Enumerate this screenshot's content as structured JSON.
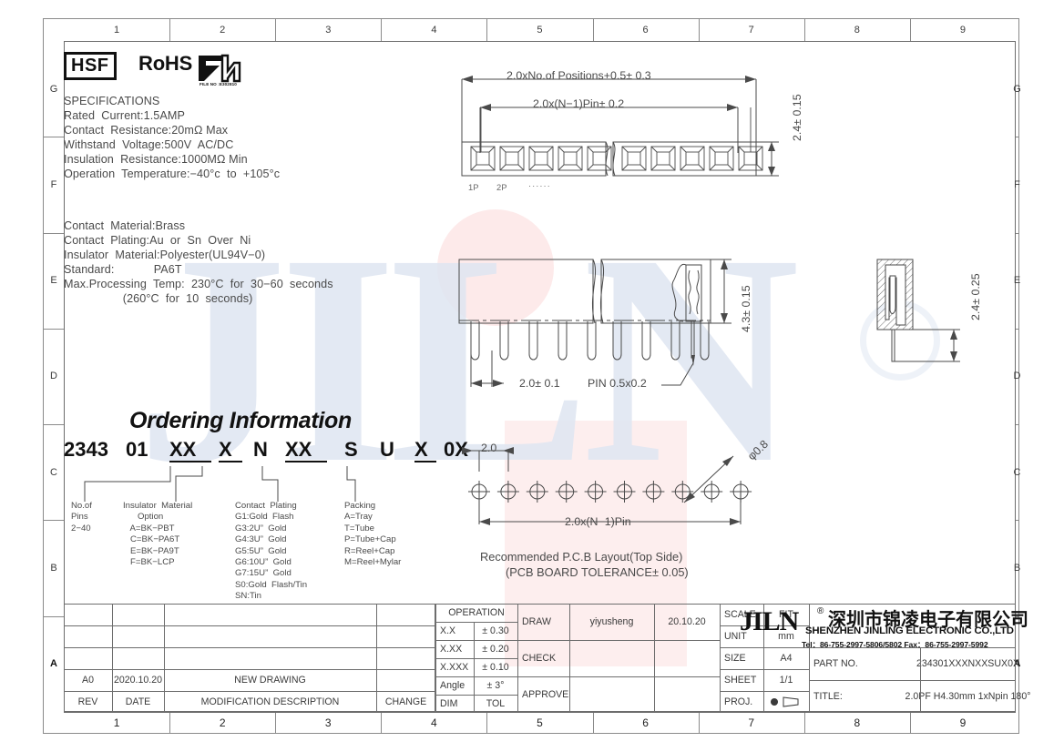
{
  "frame": {
    "columns": [
      "1",
      "2",
      "3",
      "4",
      "5",
      "6",
      "7",
      "8",
      "9"
    ],
    "rows": [
      "G",
      "F",
      "E",
      "D",
      "C",
      "B",
      "A"
    ]
  },
  "compliance": {
    "hsf": "HSF",
    "rohs": "RoHS",
    "ul_file": "FILE NO :E302810"
  },
  "specifications": {
    "heading": "SPECIFICATIONS",
    "lines": [
      "Rated  Current:1.5AMP",
      "Contact  Resistance:20mΩ Max",
      "Withstand  Voltage:500V  AC/DC",
      "Insulation  Resistance:1000MΩ Min",
      "Operation  Temperature:−40°c  to  +105°c"
    ],
    "materials": [
      "Contact  Material:Brass",
      "Contact  Plating:Au  or  Sn  Over  Ni",
      "Insulator  Material:Polyester(UL94V−0)",
      "Standard:            PA6T",
      "Max.Processing  Temp:  230°C  for  30−60  seconds",
      "                  (260°C  for  10  seconds)"
    ]
  },
  "ordering": {
    "title": "Ordering Information",
    "code_parts": [
      "2343",
      "01",
      "XX",
      "X",
      "N",
      "XX",
      "S",
      "U",
      "X",
      "0X"
    ],
    "groups": [
      {
        "name": "No.of\nPins\n2−40"
      },
      {
        "name": "Insulator  Material\n      Option\n   A=BK−PBT\n   C=BK−PA6T\n   E=BK−PA9T\n   F=BK−LCP"
      },
      {
        "name": "Contact  Plating\nG1:Gold  Flash\nG3:2U”  Gold\nG4:3U”  Gold\nG5:5U”  Gold\nG6:10U”  Gold\nG7:15U”  Gold\nS0:Gold  Flash/Tin\nSN:Tin"
      },
      {
        "name": "Packing\nA=Tray\nT=Tube\nP=Tube+Cap\nR=Reel+Cap\nM=Reel+Mylar"
      }
    ]
  },
  "drawing": {
    "top_view": {
      "dim_overall": "2.0xNo.of  Positions+0.5± 0.3",
      "dim_pitch_span": "2.0x(N−1)Pin± 0.2",
      "dim_height": "2.4± 0.15",
      "pin_labels": [
        "1P",
        "2P",
        "······"
      ]
    },
    "side_view": {
      "dim_body_height": "4.3± 0.15",
      "dim_pitch": "2.0± 0.1",
      "pin_note": "PIN  0.5x0.2"
    },
    "end_view": {
      "dim_width": "2.4± 0.25"
    },
    "pcb_layout": {
      "dim_pitch": "2.0",
      "dim_span": "2.0x(N−1)Pin",
      "hole_dia": "φ0.8",
      "caption1": "Recommended  P.C.B  Layout(Top  Side)",
      "caption2": "(PCB  BOARD  TOLERANCE± 0.05)"
    }
  },
  "revision_table": {
    "headers": [
      "REV",
      "DATE",
      "MODIFICATION  DESCRIPTION",
      "CHANGE"
    ],
    "rows": [
      {
        "rev": "A0",
        "date": "2020.10.20",
        "description": "NEW  DRAWING",
        "change": ""
      },
      {
        "rev": "",
        "date": "",
        "description": "",
        "change": ""
      },
      {
        "rev": "",
        "date": "",
        "description": "",
        "change": ""
      },
      {
        "rev": "",
        "date": "",
        "description": "",
        "change": ""
      }
    ]
  },
  "title_block": {
    "operation_header": "OPERATION",
    "tolerance_rows": [
      {
        "dim": "X.X",
        "tol": "± 0.30"
      },
      {
        "dim": "X.XX",
        "tol": "± 0.20"
      },
      {
        "dim": "X.XXX",
        "tol": "± 0.10"
      },
      {
        "dim": "Angle",
        "tol": "± 3°"
      }
    ],
    "tolerance_footer": {
      "dim": "DIM",
      "tol": "TOL"
    },
    "approvals": [
      {
        "role": "DRAW",
        "name": "yiyusheng",
        "date": "20.10.20"
      },
      {
        "role": "CHECK",
        "name": "",
        "date": ""
      },
      {
        "role": "APPROVE",
        "name": "",
        "date": ""
      }
    ],
    "properties": [
      {
        "key": "SCALE",
        "value": "FIT"
      },
      {
        "key": "UNIT",
        "value": "mm"
      },
      {
        "key": "SIZE",
        "value": "A4"
      },
      {
        "key": "SHEET",
        "value": "1/1"
      },
      {
        "key": "PROJ.",
        "value": ""
      }
    ],
    "company": {
      "logo": "JILN",
      "registered": "®",
      "name_cn": "深圳市锦凌电子有限公司",
      "name_en": "SHENZHEN JINLING ELECTRONIC CO.,LTD",
      "contact": "Tel：86-755-2997-5806/5802    Fax：86-755-2997-5992"
    },
    "part": {
      "label": "PART  NO.",
      "value": "234301XXXNXXSUX0X"
    },
    "title": {
      "label": "TITLE:",
      "value": "2.0PF  H4.30mm  1xNpin  180°"
    }
  },
  "colors": {
    "line": "#4a4a4a",
    "frame": "#6d6d6d",
    "text": "#231f20",
    "watermark_blue": "#dfe6f2",
    "watermark_pink": "#fdeaea"
  }
}
